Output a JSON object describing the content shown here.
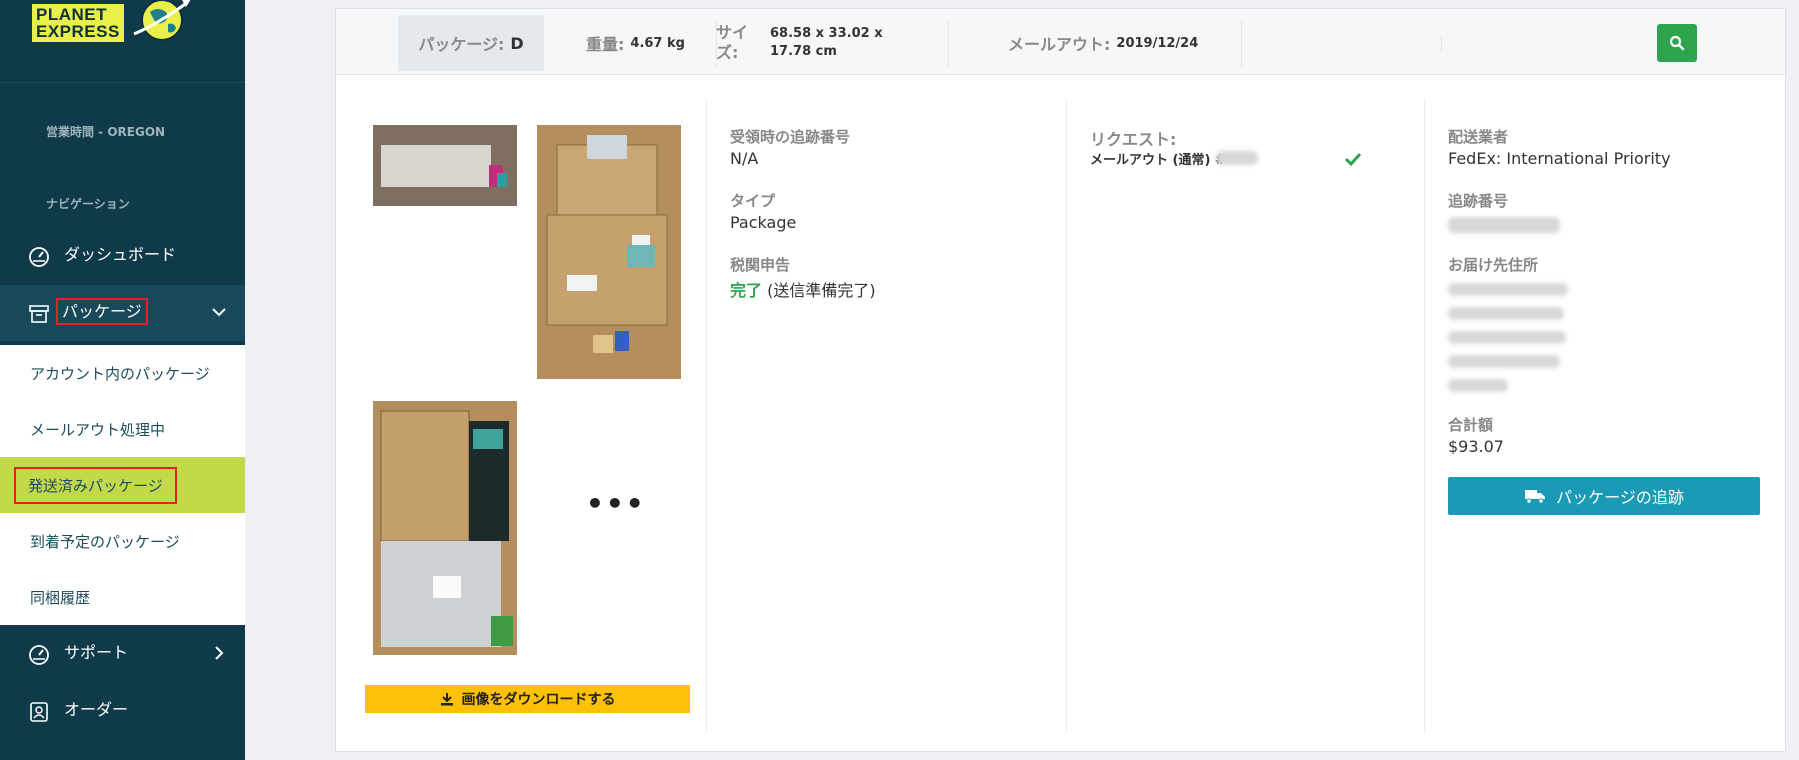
{
  "brand": {
    "line1": "PLANET",
    "line2": "EXPRESS"
  },
  "sidebar": {
    "hours_label": "営業時間 - OREGON",
    "nav_label": "ナビゲーション",
    "items": [
      {
        "label": "ダッシュボード",
        "icon": "gauge-icon"
      },
      {
        "label": "パッケージ",
        "icon": "archive-box-icon"
      },
      {
        "label": "サポート",
        "icon": "gauge-icon"
      },
      {
        "label": "オーダー",
        "icon": "contact-card-icon"
      }
    ],
    "submenu": [
      {
        "label": "アカウント内のパッケージ"
      },
      {
        "label": "メールアウト処理中"
      },
      {
        "label": "発送済みパッケージ"
      },
      {
        "label": "到着予定のパッケージ"
      },
      {
        "label": "同梱履歴"
      }
    ]
  },
  "header": {
    "package_label": "パッケージ:",
    "package_value": "D",
    "weight_label": "重量:",
    "weight_value": "4.67 kg",
    "size_label": "サイズ:",
    "size_value": "68.58 x 33.02 x 17.78 cm",
    "mailout_label": "メールアウト:",
    "mailout_value": "2019/12/24"
  },
  "gallery": {
    "more": "•••",
    "download_label": "画像をダウンロードする"
  },
  "details": {
    "tracking_in_label": "受領時の追跡番号",
    "tracking_in_value": "N/A",
    "type_label": "タイプ",
    "type_value": "Package",
    "customs_label": "税関申告",
    "customs_status": "完了",
    "customs_note": "(送信準備完了)"
  },
  "request": {
    "label": "リクエスト:",
    "value": "メールアウト (通常) #"
  },
  "shipping": {
    "carrier_label": "配送業者",
    "carrier_value": "FedEx: International Priority",
    "tracking_label": "追跡番号",
    "address_label": "お届け先住所",
    "total_label": "合計額",
    "total_value": "$93.07",
    "track_button": "パッケージの追跡"
  },
  "colors": {
    "sidebar_bg": "#0f3a4a",
    "accent_green": "#2ea44f",
    "highlight": "#c4d94a",
    "track_blue": "#1a9bb5",
    "download_yellow": "#ffc107"
  }
}
